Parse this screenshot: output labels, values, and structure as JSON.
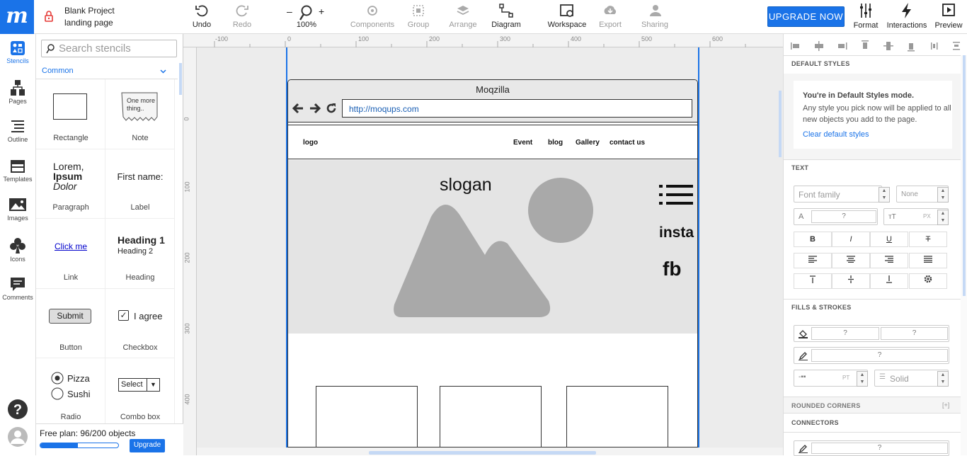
{
  "app": {
    "logo": "m"
  },
  "project": {
    "name": "Blank Project",
    "page": "landing page"
  },
  "toolbar": {
    "undo": "Undo",
    "redo": "Redo",
    "zoom": "100%",
    "zoom_minus": "–",
    "zoom_plus": "+",
    "components": "Components",
    "group": "Group",
    "arrange": "Arrange",
    "diagram": "Diagram",
    "workspace": "Workspace",
    "export": "Export",
    "sharing": "Sharing",
    "upgrade": "UPGRADE NOW",
    "format": "Format",
    "interactions": "Interactions",
    "preview": "Preview"
  },
  "rail": {
    "stencils": "Stencils",
    "pages": "Pages",
    "outline": "Outline",
    "templates": "Templates",
    "images": "Images",
    "icons": "Icons",
    "comments": "Comments"
  },
  "stencils": {
    "search_placeholder": "Search stencils",
    "category": "Common",
    "items": [
      "Rectangle",
      "Note",
      "Paragraph",
      "Label",
      "Link",
      "Heading",
      "Button",
      "Checkbox",
      "Radio",
      "Combo box"
    ],
    "note_text": "One more thing..",
    "para_1": "Lorem,",
    "para_2": "Ipsum",
    "para_3": "Dolor",
    "label_text": "First name:",
    "link_text": "Click me",
    "heading_1": "Heading 1",
    "heading_2": "Heading 2",
    "button_text": "Submit",
    "checkbox_text": "I agree",
    "radio_1": "Pizza",
    "radio_2": "Sushi",
    "combo_text": "Select"
  },
  "plan": {
    "text": "Free plan: 96/200 objects",
    "used": 96,
    "limit": 200,
    "upgrade": "Upgrade"
  },
  "rulers": {
    "h": [
      "-100",
      "0",
      "100",
      "200",
      "300",
      "400",
      "500",
      "600"
    ],
    "v": [
      "0",
      "100",
      "200",
      "300",
      "400"
    ]
  },
  "mockup": {
    "browser_title": "Moqzilla",
    "url": "http://moqups.com",
    "nav_logo": "logo",
    "nav": [
      "Event",
      "blog",
      "Gallery",
      "contact us"
    ],
    "slogan": "slogan",
    "insta": "insta",
    "fb": "fb"
  },
  "format": {
    "default_styles": "DEFAULT STYLES",
    "mode_title": "You're in Default Styles mode.",
    "mode_desc": "Any style you pick now will be applied to all new objects you add to the page.",
    "clear": "Clear default styles",
    "text": "TEXT",
    "font_family": "Font family",
    "none": "None",
    "q": "?",
    "px": "PX",
    "pt": "PT",
    "solid": "Solid",
    "fills": "FILLS & STROKES",
    "rounded": "ROUNDED CORNERS",
    "rounded_add": "[+]",
    "connectors": "CONNECTORS"
  },
  "colors": {
    "accent": "#1a73e8",
    "placeholder": "#a9a9a9",
    "canvas": "#ececec"
  }
}
